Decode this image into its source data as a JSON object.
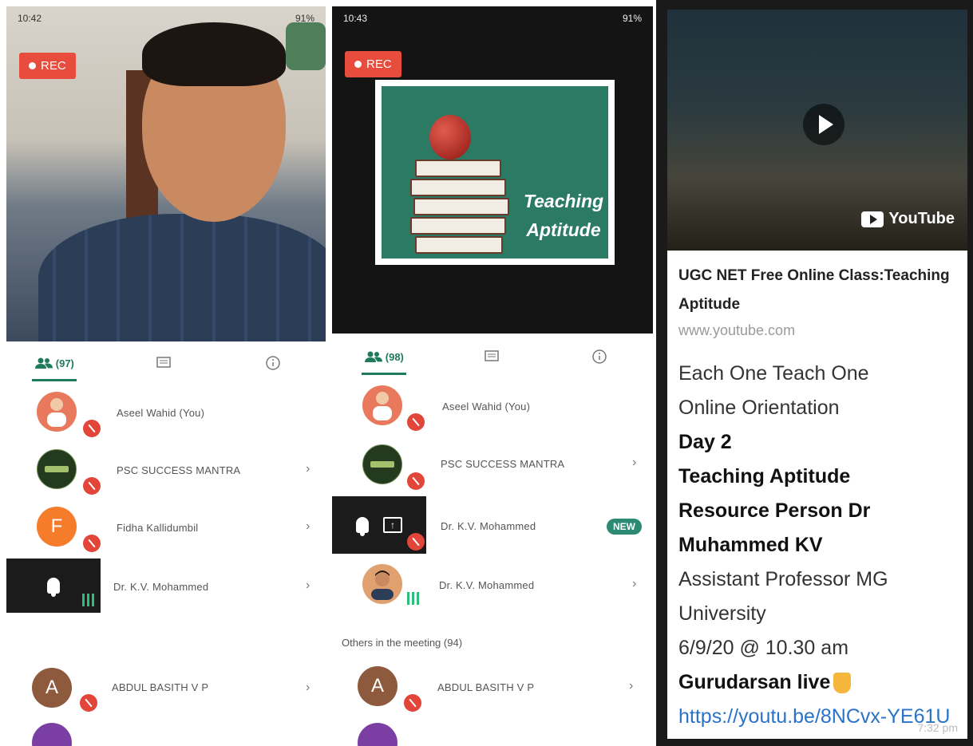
{
  "panel1": {
    "status_time": "10:42",
    "status_battery": "91%",
    "rec_label": "REC",
    "tabs": {
      "participants_count": "(97)"
    },
    "participants": [
      {
        "name": "Aseel Wahid (You)"
      },
      {
        "name": "PSC SUCCESS MANTRA"
      },
      {
        "name": "Fidha Kallidumbil",
        "initial": "F",
        "color": "#f57c2b"
      },
      {
        "name": "Dr. K.V. Mohammed"
      },
      {
        "name": "ABDUL BASITH V P",
        "initial": "A",
        "color": "#8d5a3e"
      }
    ]
  },
  "panel2": {
    "status_time": "10:43",
    "status_battery": "91%",
    "rec_label": "REC",
    "slide": {
      "line1": "Teaching",
      "line2": "Aptitude"
    },
    "tabs": {
      "participants_count": "(98)"
    },
    "participants": [
      {
        "name": "Aseel Wahid (You)"
      },
      {
        "name": "PSC SUCCESS MANTRA"
      },
      {
        "name": "Dr. K.V. Mohammed",
        "badge": "NEW"
      },
      {
        "name": "Dr. K.V. Mohammed"
      }
    ],
    "others_label": "Others in the meeting (94)",
    "others": [
      {
        "name": "ABDUL BASITH V P",
        "initial": "A",
        "color": "#8d5a3e"
      }
    ]
  },
  "panel3": {
    "youtube_label": "YouTube",
    "link_title": "UGC NET Free Online Class:Teaching Aptitude",
    "link_domain": "www.youtube.com",
    "lines": [
      "Each One Teach One",
      "Online Orientation",
      "Day 2",
      "Teaching Aptitude",
      "Resource Person Dr Muhammed KV",
      "Assistant Professor MG University",
      "6/9/20 @ 10.30 am",
      "Gurudarsan live"
    ],
    "url": "https://youtu.be/8NCvx-YE61U",
    "time": "7:32 pm"
  },
  "colors": {
    "accent": "#1f7a5c",
    "rec": "#e74c3c",
    "mute": "#e2453a",
    "link": "#2a73c8"
  }
}
